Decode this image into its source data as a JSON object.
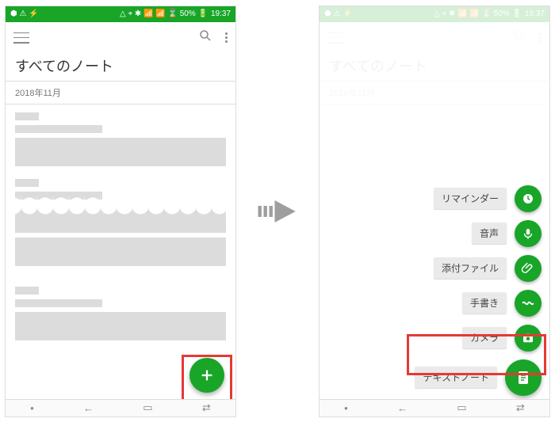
{
  "status": {
    "left_icons": "⬢ ⚠ ⚡",
    "right_icons": "△ ⌖ ✱ 📶 📶 ⌛ 50% 🔋",
    "time": "19:37"
  },
  "toolbar": {},
  "page": {
    "title": "すべてのノート",
    "section": "2018年11月"
  },
  "nav": {
    "dot": "•",
    "back": "←",
    "recent": "▭",
    "switch": "⇄"
  },
  "fab_menu": {
    "reminder": "リマインダー",
    "audio": "音声",
    "attachment": "添付ファイル",
    "handwriting": "手書き",
    "camera": "カメラ",
    "text_note": "テキストノート"
  }
}
